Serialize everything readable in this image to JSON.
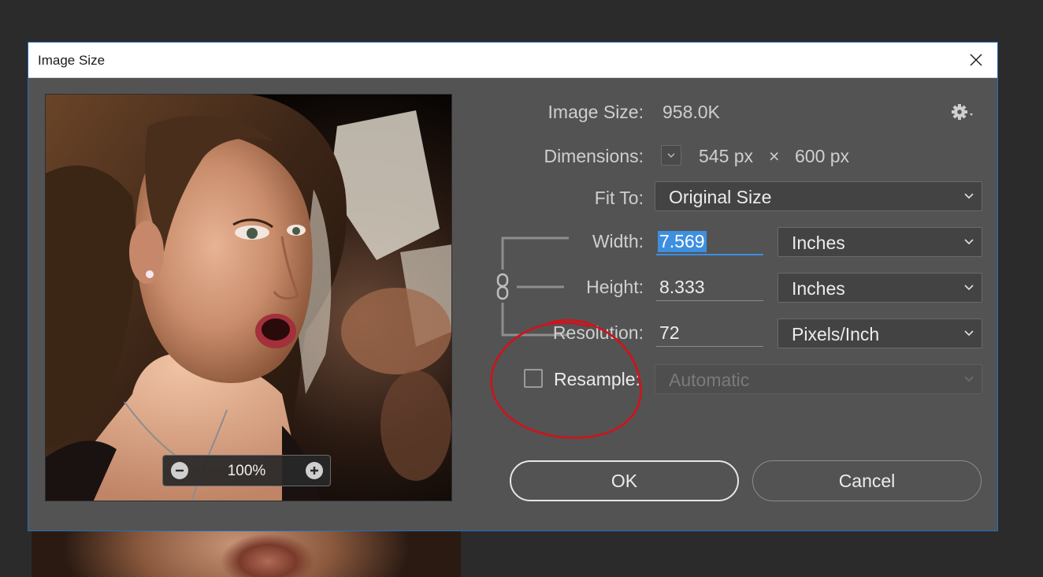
{
  "dialog": {
    "title": "Image Size"
  },
  "preview": {
    "zoom": "100%"
  },
  "info": {
    "image_size_label": "Image Size:",
    "image_size_value": "958.0K",
    "dimensions_label": "Dimensions:",
    "dim_width": "545 px",
    "dim_times": "×",
    "dim_height": "600 px"
  },
  "fit_to": {
    "label": "Fit To:",
    "value": "Original Size"
  },
  "width": {
    "label": "Width:",
    "value": "7.569",
    "unit": "Inches"
  },
  "height": {
    "label": "Height:",
    "value": "8.333",
    "unit": "Inches"
  },
  "resolution": {
    "label": "Resolution:",
    "value": "72",
    "unit": "Pixels/Inch"
  },
  "resample": {
    "label": "Resample:",
    "checked": false,
    "value": "Automatic"
  },
  "buttons": {
    "ok": "OK",
    "cancel": "Cancel"
  },
  "colors": {
    "dialog_bg": "#535353",
    "accent": "#3d8fe0",
    "annotation": "#d0121b"
  },
  "icons": [
    "close-icon",
    "zoom-out-icon",
    "zoom-in-icon",
    "gear-icon",
    "chevron-down-icon",
    "link-icon"
  ]
}
